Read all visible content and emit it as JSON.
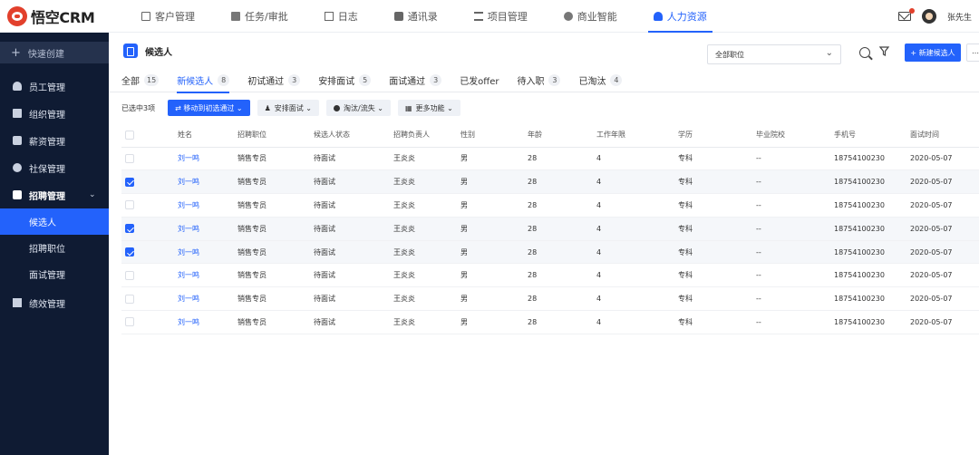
{
  "app": {
    "logo_text": "悟空CRM",
    "user_name": "张先生"
  },
  "topnav": [
    {
      "label": "客户管理",
      "icon": "customer-icon"
    },
    {
      "label": "任务/审批",
      "icon": "task-icon"
    },
    {
      "label": "日志",
      "icon": "log-icon"
    },
    {
      "label": "通讯录",
      "icon": "contacts-icon"
    },
    {
      "label": "项目管理",
      "icon": "project-icon"
    },
    {
      "label": "商业智能",
      "icon": "bi-icon"
    },
    {
      "label": "人力资源",
      "icon": "hr-icon",
      "active": true
    }
  ],
  "sidebar": {
    "quick_create": "快速创建",
    "items": [
      {
        "label": "员工管理"
      },
      {
        "label": "组织管理"
      },
      {
        "label": "薪资管理"
      },
      {
        "label": "社保管理"
      },
      {
        "label": "招聘管理"
      }
    ],
    "sub_items": [
      {
        "label": "候选人",
        "active": true
      },
      {
        "label": "招聘职位"
      },
      {
        "label": "面试管理"
      }
    ],
    "last_item": {
      "label": "绩效管理"
    }
  },
  "header": {
    "title": "候选人",
    "position_select": "全部职位",
    "new_button": "+ 新建候选人"
  },
  "tabs": [
    {
      "label": "全部",
      "count": "15"
    },
    {
      "label": "新候选人",
      "count": "8",
      "active": true
    },
    {
      "label": "初试通过",
      "count": "3"
    },
    {
      "label": "安排面试",
      "count": "5"
    },
    {
      "label": "面试通过",
      "count": "3"
    },
    {
      "label": "已发offer",
      "count": ""
    },
    {
      "label": "待入职",
      "count": "3"
    },
    {
      "label": "已淘汰",
      "count": "4"
    }
  ],
  "actions": {
    "selected_text": "已选中3项",
    "move": "⇄ 移动到初选通过 ⌄",
    "arrange": "安排面试 ⌄",
    "eliminate": "淘汰/流失 ⌄",
    "more": "更多功能 ⌄"
  },
  "table": {
    "columns": [
      "姓名",
      "招聘职位",
      "候选人状态",
      "招聘负责人",
      "性别",
      "年龄",
      "工作年限",
      "学历",
      "毕业院校",
      "手机号",
      "面试时间"
    ],
    "rows": [
      {
        "checked": false,
        "cells": [
          "刘一鸣",
          "销售专员",
          "待面试",
          "王炎炎",
          "男",
          "28",
          "4",
          "专科",
          "--",
          "18754100230",
          "2020-05-07"
        ]
      },
      {
        "checked": true,
        "cells": [
          "刘一鸣",
          "销售专员",
          "待面试",
          "王炎炎",
          "男",
          "28",
          "4",
          "专科",
          "--",
          "18754100230",
          "2020-05-07"
        ]
      },
      {
        "checked": false,
        "cells": [
          "刘一鸣",
          "销售专员",
          "待面试",
          "王炎炎",
          "男",
          "28",
          "4",
          "专科",
          "--",
          "18754100230",
          "2020-05-07"
        ]
      },
      {
        "checked": true,
        "cells": [
          "刘一鸣",
          "销售专员",
          "待面试",
          "王炎炎",
          "男",
          "28",
          "4",
          "专科",
          "--",
          "18754100230",
          "2020-05-07"
        ]
      },
      {
        "checked": true,
        "cells": [
          "刘一鸣",
          "销售专员",
          "待面试",
          "王炎炎",
          "男",
          "28",
          "4",
          "专科",
          "--",
          "18754100230",
          "2020-05-07"
        ]
      },
      {
        "checked": false,
        "cells": [
          "刘一鸣",
          "销售专员",
          "待面试",
          "王炎炎",
          "男",
          "28",
          "4",
          "专科",
          "--",
          "18754100230",
          "2020-05-07"
        ]
      },
      {
        "checked": false,
        "cells": [
          "刘一鸣",
          "销售专员",
          "待面试",
          "王炎炎",
          "男",
          "28",
          "4",
          "专科",
          "--",
          "18754100230",
          "2020-05-07"
        ]
      },
      {
        "checked": false,
        "cells": [
          "刘一鸣",
          "销售专员",
          "待面试",
          "王炎炎",
          "男",
          "28",
          "4",
          "专科",
          "--",
          "18754100230",
          "2020-05-07"
        ]
      }
    ]
  },
  "colors": {
    "accent": "#2362fb",
    "sidebar_bg": "#0f1b33"
  }
}
